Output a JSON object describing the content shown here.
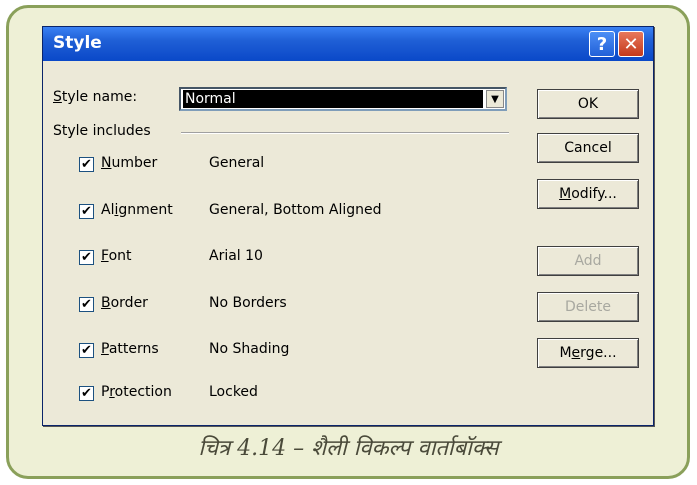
{
  "dialog": {
    "title": "Style",
    "help_glyph": "?",
    "close_glyph": "✕"
  },
  "style_name": {
    "label_mnemonic": "S",
    "label_rest": "tyle name:",
    "value": "Normal"
  },
  "style_includes_label": "Style includes",
  "items": [
    {
      "pre": "",
      "mn": "N",
      "post": "umber",
      "value": "General",
      "checked": true
    },
    {
      "pre": "Al",
      "mn": "i",
      "post": "gnment",
      "value": "General, Bottom Aligned",
      "checked": true
    },
    {
      "pre": "",
      "mn": "F",
      "post": "ont",
      "value": "Arial 10",
      "checked": true
    },
    {
      "pre": "",
      "mn": "B",
      "post": "order",
      "value": "No Borders",
      "checked": true
    },
    {
      "pre": "",
      "mn": "P",
      "post": "atterns",
      "value": "No Shading",
      "checked": true
    },
    {
      "pre": "P",
      "mn": "r",
      "post": "otection",
      "value": "Locked",
      "checked": true
    }
  ],
  "buttons": {
    "ok": "OK",
    "cancel": "Cancel",
    "modify_mn": "M",
    "modify_rest": "odify...",
    "add": "Add",
    "delete": "Delete",
    "merge_pre": "M",
    "merge_mn": "e",
    "merge_rest": "rge..."
  },
  "caption": "चित्र 4.14 – शैली विकल्प वार्ताबॉक्स"
}
